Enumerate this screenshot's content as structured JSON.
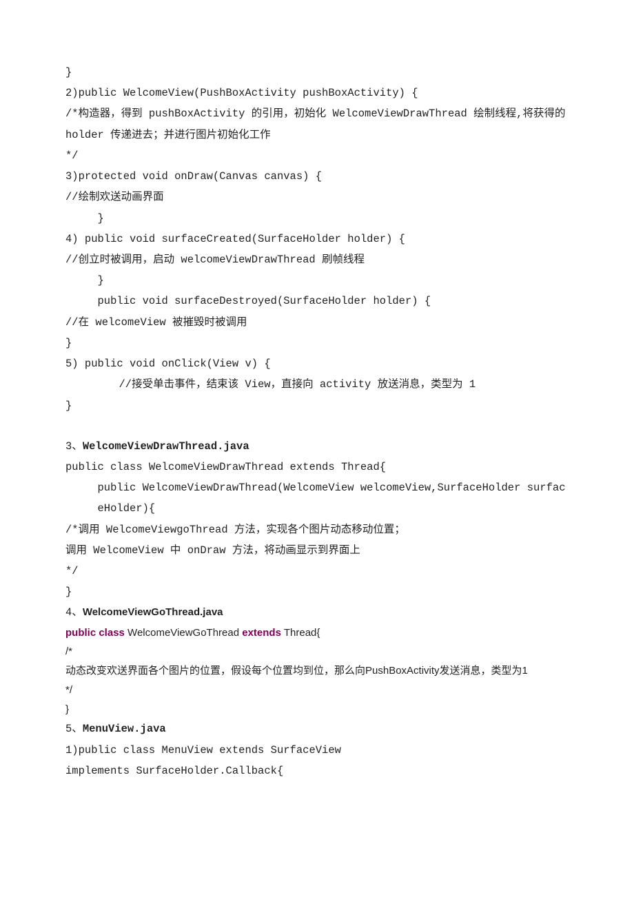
{
  "block1": {
    "l1": "}",
    "l2": "2)public WelcomeView(PushBoxActivity pushBoxActivity) {",
    "l3": "/*构造器，得到 pushBoxActivity 的引用，初始化 WelcomeViewDrawThread 绘制线程,将获得的 holder 传递进去；并进行图片初始化工作",
    "l4": "*/",
    "l5": "3)protected void onDraw(Canvas canvas) {",
    "l6": "//绘制欢送动画界面",
    "l7": "}",
    "l8": "4) public void surfaceCreated(SurfaceHolder holder) {",
    "l9": "//创立时被调用，启动 welcomeViewDrawThread 刷帧线程",
    "l10": "}",
    "l11": "public void surfaceDestroyed(SurfaceHolder holder) {",
    "l12": "//在 welcomeView 被摧毁时被调用",
    "l13": "}",
    "l14": "5) public void onClick(View v) {",
    "l15": "//接受单击事件，结束该 View，直接向 activity 放送消息，类型为 1",
    "l16": "}"
  },
  "sec3": {
    "num": "3、",
    "name": "WelcomeViewDrawThread.java",
    "l1": "public class WelcomeViewDrawThread extends Thread{",
    "l2": "public WelcomeViewDrawThread(WelcomeView welcomeView,SurfaceHolder surfaceHolder){",
    "l3": "/*调用 WelcomeViewgoThread 方法，实现各个图片动态移动位置；",
    "l4": "调用 WelcomeView 中 onDraw 方法，将动画显示到界面上",
    "l5": "*/",
    "l6": "}"
  },
  "sec4": {
    "num": "4、",
    "title": "WelcomeViewGoThread.java",
    "kw_public": "public",
    "kw_class": " class",
    "mid": " WelcomeViewGoThread ",
    "kw_extends": "extends",
    "tail": " Thread{",
    "l1": "/*",
    "l2": "动态改变欢送界面各个图片的位置，假设每个位置均到位，那么向PushBoxActivity发送消息，类型为1",
    "l3": "*/",
    "l4": "}"
  },
  "sec5": {
    "num": "5、",
    "name": "MenuView.java",
    "l1": "1)public class MenuView extends SurfaceView",
    "l2": "implements SurfaceHolder.Callback{"
  }
}
